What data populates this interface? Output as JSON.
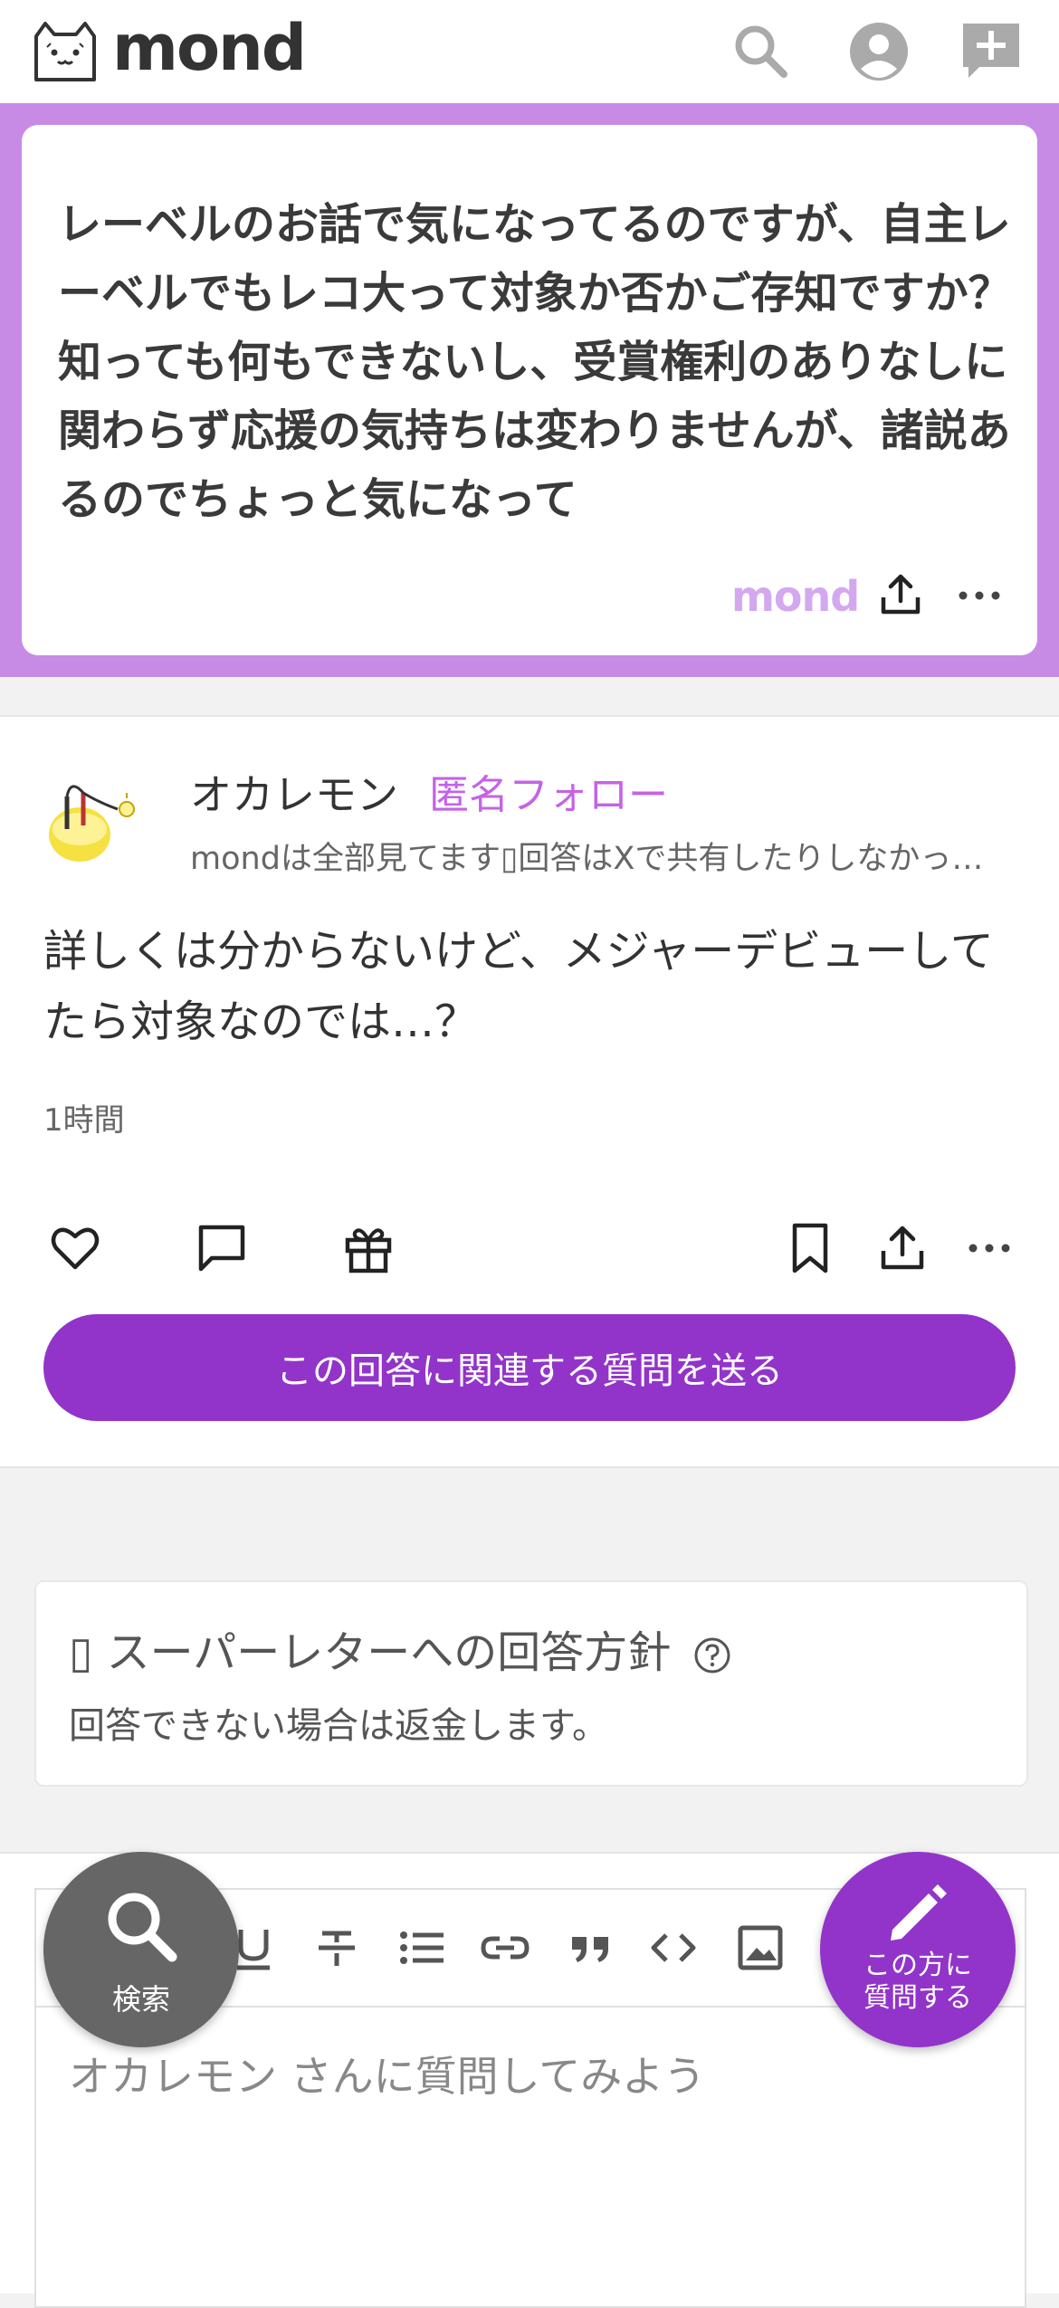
{
  "header": {
    "logo_text": "mond",
    "icons": [
      "search-icon",
      "account-icon",
      "add-question-icon"
    ]
  },
  "question": {
    "text": "レーベルのお話で気になってるのですが、自主レーベルでもレコ大って対象か否かご存知ですか？知っても何もできないし、受賞権利のありなしに関わらず応援の気持ちは変わりませんが、諸説あるのでちょっと気になって",
    "brand_mark": "mond"
  },
  "answer": {
    "author_name": "オカレモン",
    "anon_follow_label": "匿名フォロー",
    "author_bio": "mondは全部見てます▯回答はXで共有したりしなかったり",
    "text": "詳しくは分からないけど、メジャーデビューしてたら対象なのでは…？",
    "time": "1時間",
    "ask_related_label": "この回答に関連する質問を送る"
  },
  "policy": {
    "title": "▯ スーパーレターへの回答方針",
    "body": "回答できない場合は返金します。"
  },
  "editor": {
    "placeholder": "オカレモン さんに質問してみよう"
  },
  "fab": {
    "search_label": "検索",
    "ask_label_1": "この方に",
    "ask_label_2": "質問する"
  },
  "colors": {
    "accent": "#9234c9",
    "question_band": "#c78be6",
    "anon_follow": "#c463e6"
  }
}
